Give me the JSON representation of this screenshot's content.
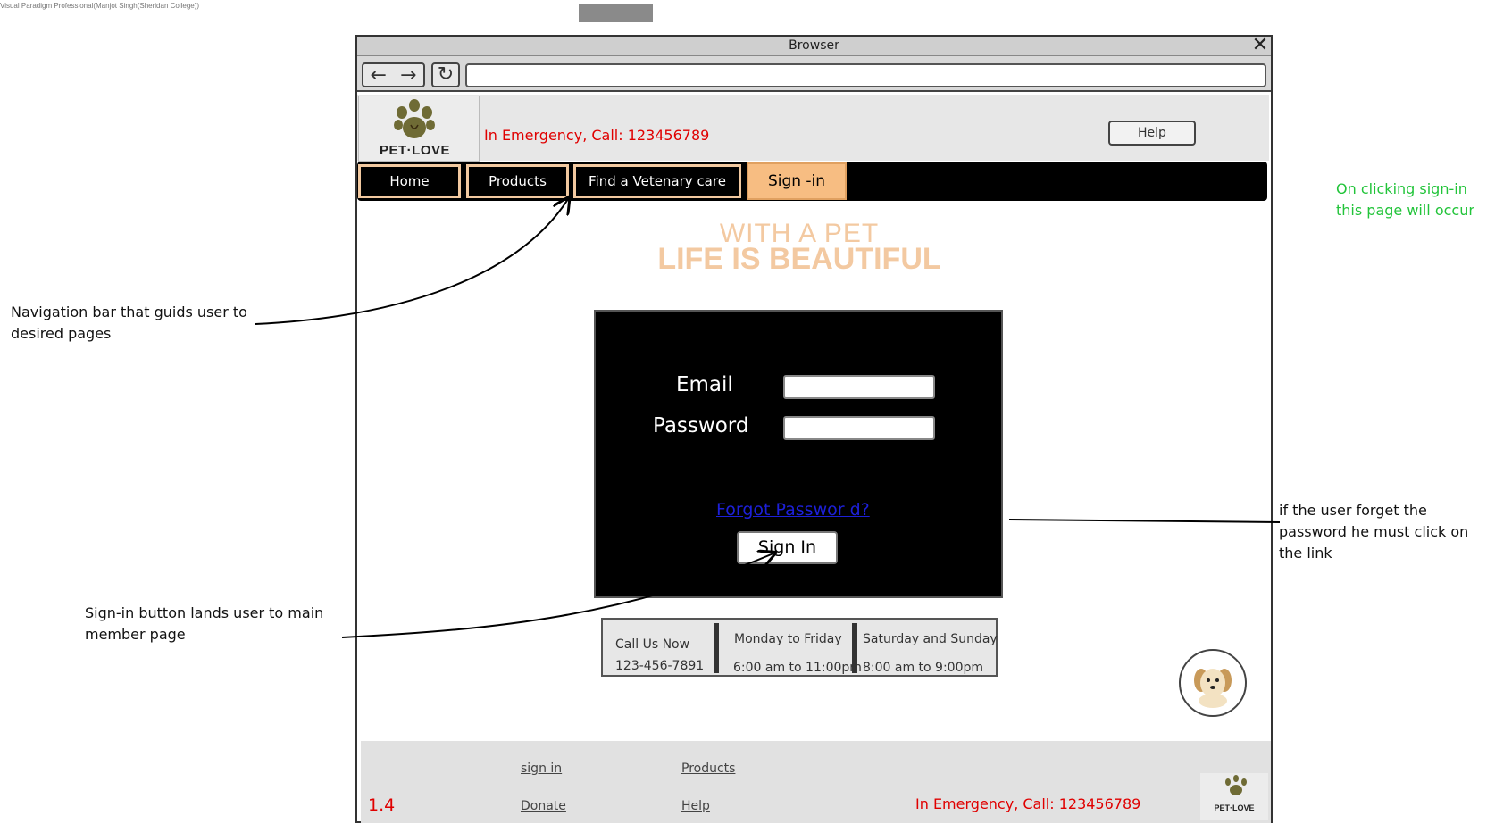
{
  "watermark": "Visual Paradigm Professional(Manjot Singh(Sheridan College))",
  "browser": {
    "title": "Browser",
    "url": ""
  },
  "header": {
    "logo_text": "PET·LOVE",
    "emergency": "In Emergency, Call: 123456789",
    "help_label": "Help"
  },
  "nav": {
    "items": [
      {
        "label": "Home"
      },
      {
        "label": "Products"
      },
      {
        "label": "Find a Vetenary care"
      },
      {
        "label": "Sign -in"
      }
    ],
    "active": "Sign -in"
  },
  "hero": {
    "line1": "WITH A PET",
    "line2": "LIFE IS BEAUTIFUL"
  },
  "signin": {
    "email_label": "Email",
    "email_value": "",
    "password_label": "Password",
    "password_value": "",
    "forgot_label": "Forgot Passwor d?",
    "button_label": "Sign In"
  },
  "info": {
    "call_title": "Call Us Now",
    "phone": "123-456-7891",
    "weekday_title": "Monday to Friday",
    "weekday_hours": "6:00 am to 11:00pm",
    "weekend_title": "Saturday and Sunday",
    "weekend_hours": "8:00 am to 9:00pm"
  },
  "footer": {
    "links": [
      "sign in",
      "Products",
      "Donate",
      "Help"
    ],
    "version": "1.4",
    "emergency": "In Emergency, Call: 123456789",
    "logo_text": "PET·LOVE"
  },
  "annotations": {
    "nav_note": "Navigation bar that guids user to desired pages",
    "signin_note": "Sign-in button lands user to main member page",
    "forgot_note": "if the user forget the password he must click on the link",
    "page_note": "On clicking sign-in this page will occur"
  },
  "colors": {
    "accent_peach": "#f7bd82",
    "emergency_red": "#e00000",
    "link_blue": "#1d20d8",
    "note_green": "#22c43a"
  }
}
